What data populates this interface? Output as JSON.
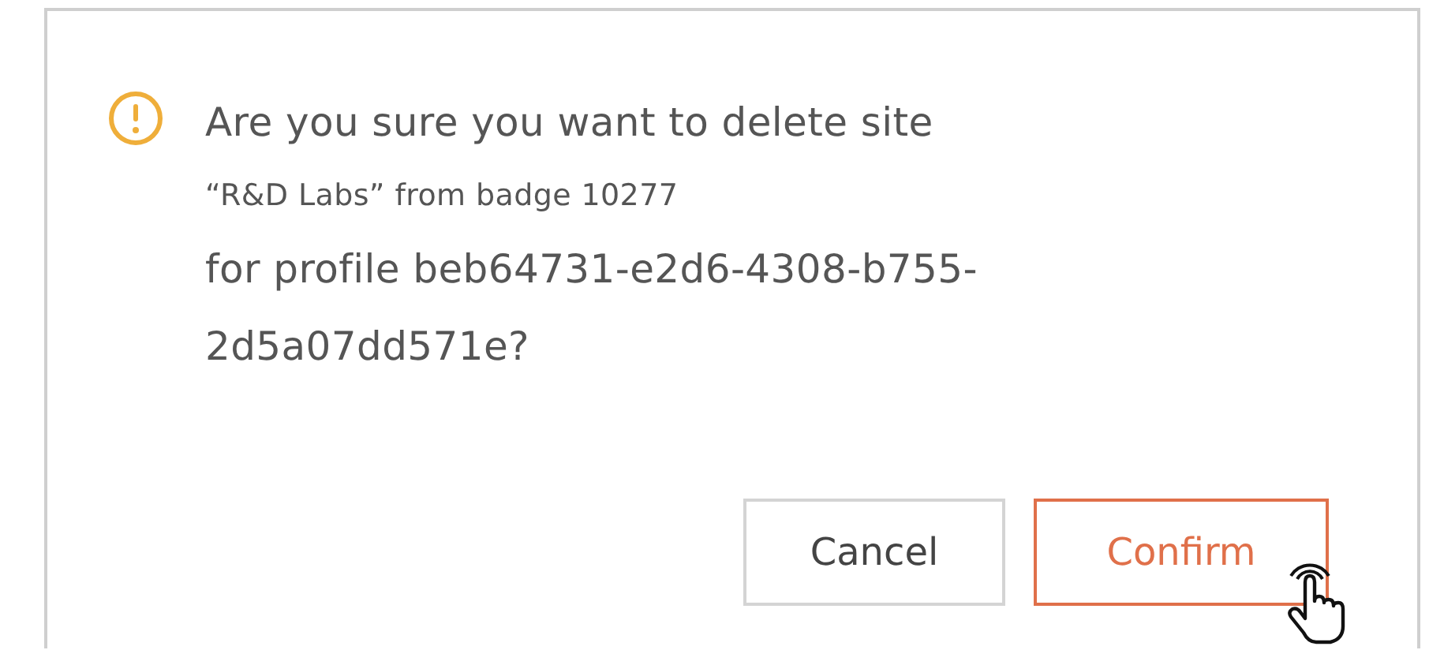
{
  "dialog": {
    "lines": [
      {
        "text": "Are you sure you want to delete site",
        "kind": "large"
      },
      {
        "text": "“R&D Labs” from badge 10277",
        "kind": "small"
      },
      {
        "text": "for profile beb64731-e2d6-4308-b755-",
        "kind": "large"
      },
      {
        "text": "2d5a07dd571e?",
        "kind": "large"
      }
    ],
    "buttons": [
      {
        "label": "Cancel",
        "kind": "secondary"
      },
      {
        "label": "Confirm",
        "kind": "primary"
      }
    ]
  }
}
